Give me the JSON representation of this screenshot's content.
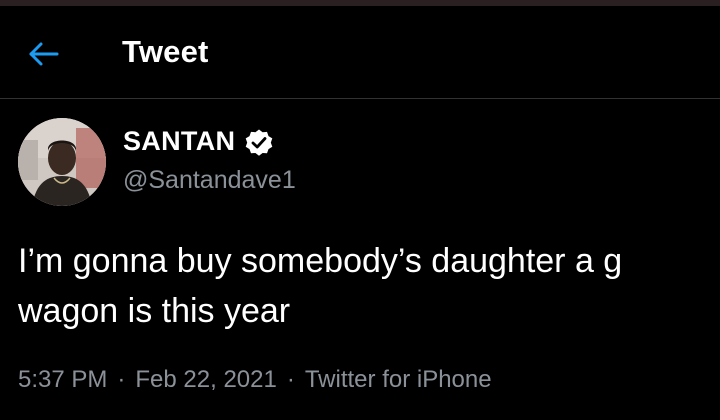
{
  "header": {
    "title": "Tweet",
    "back_icon": "arrow-left-icon",
    "accent_color": "#1d9bf0"
  },
  "tweet": {
    "author": {
      "display_name": "SANTAN",
      "handle": "@Santandave1",
      "verified": true
    },
    "text": "I’m gonna buy somebody’s daughter a g\nwagon is this year",
    "time": "5:37 PM",
    "date": "Feb 22, 2021",
    "separator": "·",
    "source": "Twitter for iPhone"
  }
}
